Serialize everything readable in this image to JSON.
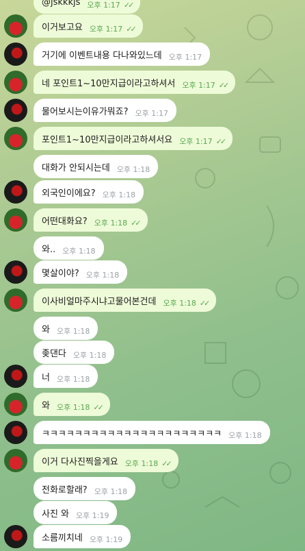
{
  "theme": {
    "incoming_bubble": "#ffffff",
    "outgoing_bubble": "#eefbd8",
    "time_outgoing": "#57a74f",
    "time_incoming": "#9aa1a6"
  },
  "messages": [
    {
      "text": "@jskkkjs",
      "time": "오후 1:17",
      "dir": "out",
      "read": true,
      "avatar": "none"
    },
    {
      "text": "이거보고요",
      "time": "오후 1:17",
      "dir": "out",
      "read": true,
      "avatar": "apple"
    },
    {
      "text": "거기에 이벤트내용 다나와있느데",
      "time": "오후 1:17",
      "dir": "in",
      "read": false,
      "avatar": "dark"
    },
    {
      "text": "네 포인트1~10만지급이라고하셔서",
      "time": "오후 1:17",
      "dir": "out",
      "read": true,
      "avatar": "apple"
    },
    {
      "text": "물어보시는이유가뭐죠?",
      "time": "오후 1:17",
      "dir": "in",
      "read": false,
      "avatar": "dark"
    },
    {
      "text": "포인트1~10만지급이라고하셔서요",
      "time": "오후 1:17",
      "dir": "out",
      "read": true,
      "avatar": "apple"
    },
    {
      "text": "대화가 안되시는데",
      "time": "오후 1:18",
      "dir": "in",
      "read": false,
      "avatar": "none"
    },
    {
      "text": "외국인이에요?",
      "time": "오후 1:18",
      "dir": "in",
      "read": false,
      "avatar": "dark"
    },
    {
      "text": "어떤대화요?",
      "time": "오후 1:18",
      "dir": "out",
      "read": true,
      "avatar": "apple"
    },
    {
      "text": "와..",
      "time": "오후 1:18",
      "dir": "in",
      "read": false,
      "avatar": "none"
    },
    {
      "text": "몇살이야?",
      "time": "오후 1:18",
      "dir": "in",
      "read": false,
      "avatar": "dark"
    },
    {
      "text": "이사비얼마주시냐고물어본건데",
      "time": "오후 1:18",
      "dir": "out",
      "read": true,
      "avatar": "apple"
    },
    {
      "text": "와",
      "time": "오후 1:18",
      "dir": "in",
      "read": false,
      "avatar": "none"
    },
    {
      "text": "좆댄다",
      "time": "오후 1:18",
      "dir": "in",
      "read": false,
      "avatar": "none"
    },
    {
      "text": "너",
      "time": "오후 1:18",
      "dir": "in",
      "read": false,
      "avatar": "dark"
    },
    {
      "text": "와",
      "time": "오후 1:18",
      "dir": "out",
      "read": true,
      "avatar": "apple"
    },
    {
      "text": "ㅋㅋㅋㅋㅋㅋㅋㅋㅋㅋㅋㅋㅋㅋㅋㅋㅋㅋㅋㅋㅋㅋ",
      "time": "오후 1:18",
      "dir": "in",
      "read": false,
      "avatar": "dark"
    },
    {
      "text": "이거 다사진찍을게요",
      "time": "오후 1:18",
      "dir": "out",
      "read": true,
      "avatar": "apple"
    },
    {
      "text": "전화로할래?",
      "time": "오후 1:18",
      "dir": "in",
      "read": false,
      "avatar": "none"
    },
    {
      "text": "사진 와",
      "time": "오후 1:19",
      "dir": "in",
      "read": false,
      "avatar": "none"
    },
    {
      "text": "소름끼치네",
      "time": "오후 1:19",
      "dir": "in",
      "read": false,
      "avatar": "dark"
    }
  ]
}
